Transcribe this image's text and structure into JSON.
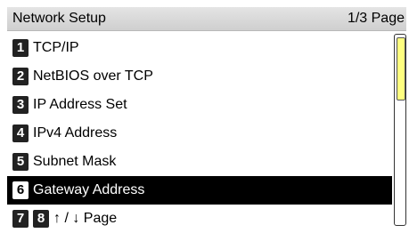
{
  "header": {
    "title": "Network Setup",
    "page_indicator": "1/3 Page"
  },
  "items": [
    {
      "num": "1",
      "label": "TCP/IP"
    },
    {
      "num": "2",
      "label": "NetBIOS over TCP"
    },
    {
      "num": "3",
      "label": "IP Address Set"
    },
    {
      "num": "4",
      "label": "IPv4 Address"
    },
    {
      "num": "5",
      "label": "Subnet Mask"
    },
    {
      "num": "6",
      "label": "Gateway Address",
      "selected": true
    }
  ],
  "footer": {
    "num_a": "7",
    "num_b": "8",
    "label": "↑ / ↓ Page"
  },
  "scroll": {
    "position_fraction": 0.0,
    "visible_fraction": 0.33,
    "thumb_color": "#ffff80"
  }
}
